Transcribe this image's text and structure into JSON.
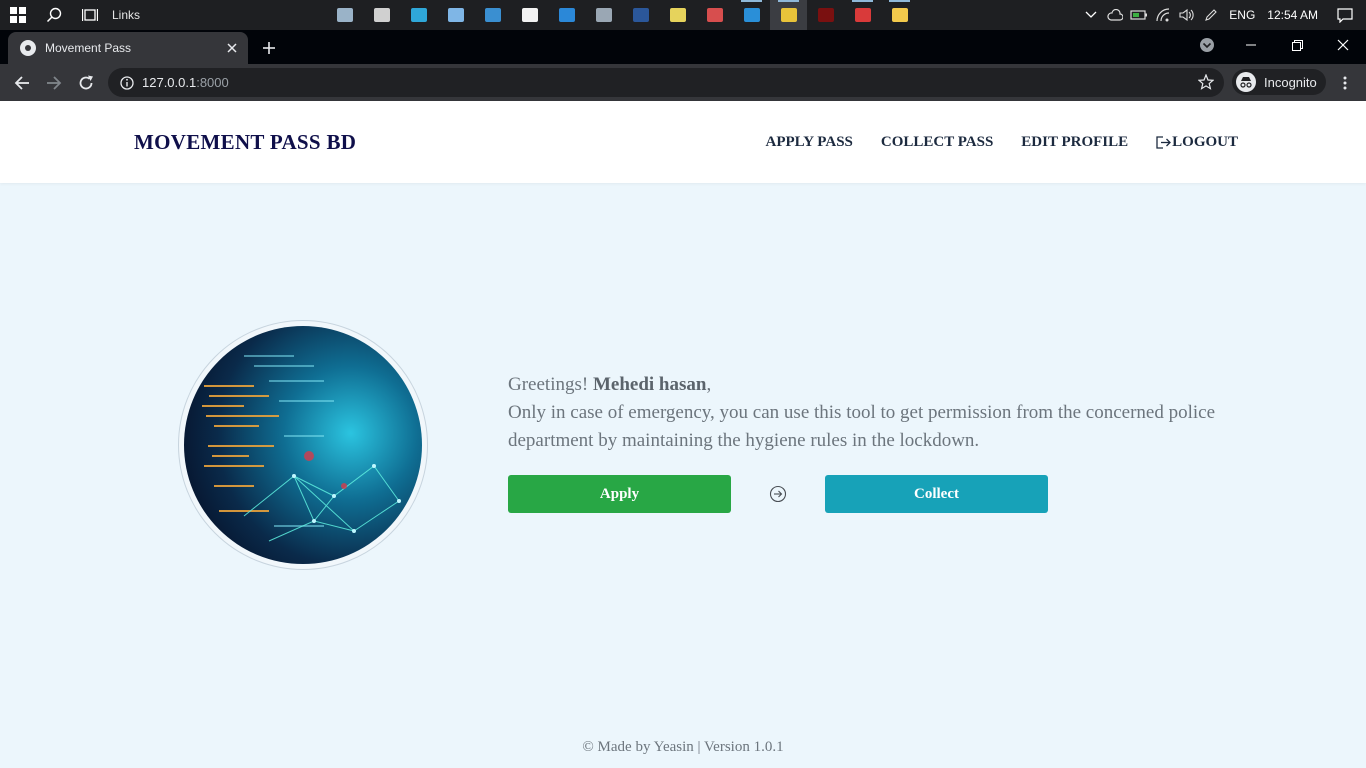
{
  "taskbar": {
    "links_label": "Links",
    "lang": "ENG",
    "time": "12:54 AM",
    "apps": [
      {
        "name": "photos-app-icon",
        "color": "#9ab3c8"
      },
      {
        "name": "cmd-app-icon",
        "color": "#d0d0d0"
      },
      {
        "name": "edge-app-icon",
        "color": "#2fa7d8"
      },
      {
        "name": "notepad-app-icon",
        "color": "#7fb6e6"
      },
      {
        "name": "remote-desktop-app-icon",
        "color": "#3a8fd1"
      },
      {
        "name": "store-app-icon",
        "color": "#f2f2f2"
      },
      {
        "name": "mail-app-icon",
        "color": "#2b88d8"
      },
      {
        "name": "calculator-app-icon",
        "color": "#9aa7b4"
      },
      {
        "name": "word-app-icon",
        "color": "#2b579a"
      },
      {
        "name": "sticky-notes-app-icon",
        "color": "#e6d35c"
      },
      {
        "name": "paint-app-icon",
        "color": "#d74e4e"
      },
      {
        "name": "vscode-app-icon",
        "color": "#2a8fd8"
      },
      {
        "name": "chrome-app-icon",
        "color": "#e8c33a"
      },
      {
        "name": "opera-app-icon",
        "color": "#7a1010"
      },
      {
        "name": "record-app-icon",
        "color": "#d93a3a"
      },
      {
        "name": "file-explorer-app-icon",
        "color": "#f2c94c"
      }
    ]
  },
  "browser": {
    "tab_title": "Movement Pass",
    "url_host": "127.0.0.1",
    "url_port": ":8000",
    "incognito_label": "Incognito"
  },
  "navbar": {
    "brand": "MOVEMENT PASS BD",
    "links": [
      "APPLY PASS",
      "COLLECT PASS",
      "EDIT PROFILE",
      "LOGOUT"
    ]
  },
  "main": {
    "greeting": "Greetings! ",
    "user_name": "Mehedi hasan",
    "greeting_suffix": ",",
    "message": "Only in case of emergency, you can use this tool to get permission from the concerned police department by maintaining the hygiene rules in the lockdown.",
    "apply_label": "Apply",
    "collect_label": "Collect"
  },
  "footer": {
    "text": "© Made by Yeasin | Version 1.0.1"
  },
  "colors": {
    "brand": "#0f0f4a",
    "apply": "#28a745",
    "collect": "#17a2b8",
    "page_bg": "#ecf6fc"
  }
}
